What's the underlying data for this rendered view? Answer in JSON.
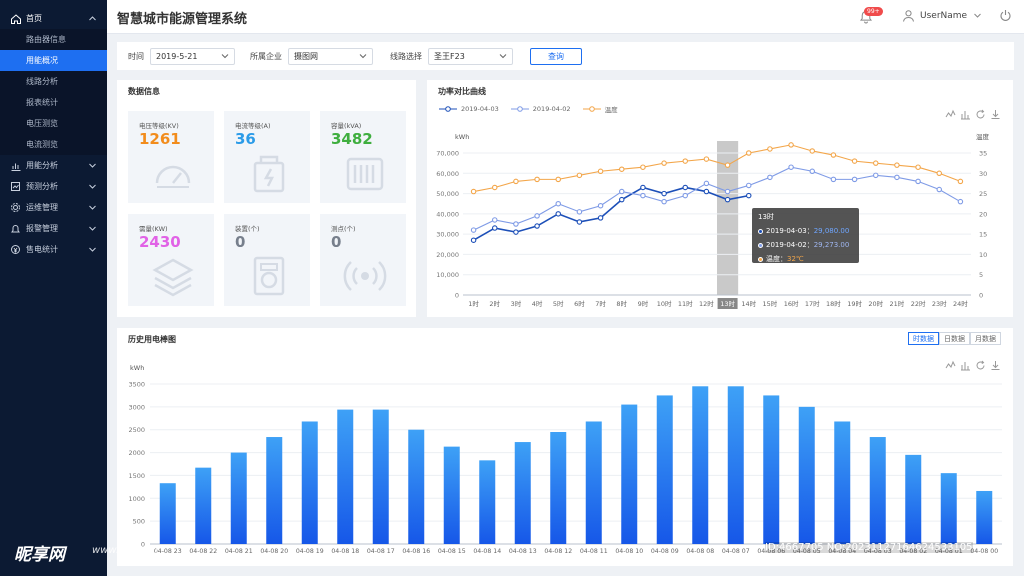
{
  "sidebar": {
    "items": [
      {
        "label": "首页",
        "icon": "home-icon",
        "expanded": true,
        "subs": [
          "路由器信息",
          "用能概况",
          "线路分析",
          "报表统计",
          "电压测览",
          "电流测览"
        ]
      },
      {
        "label": "用能分析",
        "icon": "chart-icon"
      },
      {
        "label": "预测分析",
        "icon": "forecast-icon"
      },
      {
        "label": "运维管理",
        "icon": "gear-icon"
      },
      {
        "label": "报警管理",
        "icon": "alarm-icon"
      },
      {
        "label": "售电统计",
        "icon": "coin-icon"
      }
    ],
    "active_sub": "用能概况"
  },
  "header": {
    "title": "智慧城市能源管理系统",
    "badge": "99+",
    "username": "UserName"
  },
  "filter": {
    "time_label": "时间",
    "time_value": "2019-5-21",
    "company_label": "所属企业",
    "company_value": "摄图网",
    "line_label": "线路选择",
    "line_value": "圣王F23",
    "query_label": "查询"
  },
  "data_info": {
    "title": "数据信息",
    "cards": [
      {
        "label": "电压等级(KV)",
        "value": "1261",
        "color": "#f28c1c",
        "icon": "gauge-icon"
      },
      {
        "label": "电流等级(A)",
        "value": "36",
        "color": "#2b9be8",
        "icon": "battery-icon"
      },
      {
        "label": "容量(kVA)",
        "value": "3482",
        "color": "#3fae3f",
        "icon": "transformer-icon"
      },
      {
        "label": "需量(KW)",
        "value": "2430",
        "color": "#e162e6",
        "icon": "layers-icon"
      },
      {
        "label": "装置(个)",
        "value": "0",
        "color": "#777f8c",
        "icon": "device-icon"
      },
      {
        "label": "测点(个)",
        "value": "0",
        "color": "#777f8c",
        "icon": "signal-icon"
      }
    ]
  },
  "power_chart": {
    "title": "功率对比曲线",
    "tooltip": {
      "title": "13时",
      "r1_label": "2019-04-03",
      "r1_value": "29,080.00",
      "r2_label": "2019-04-02",
      "r2_value": "29,273.00",
      "r3_label": "温度",
      "r3_value": "32℃"
    }
  },
  "bar_panel": {
    "title": "历史用电棒图",
    "tabs": [
      "时数据",
      "日数据",
      "月数据"
    ],
    "active_tab": "时数据"
  },
  "watermark": {
    "logo": "昵享网",
    "url": "www.nipic.cn",
    "id": "ID:4667705 NO:20231127164624533105"
  },
  "chart_data": [
    {
      "type": "line",
      "title": "功率对比曲线",
      "categories": [
        "1时",
        "2时",
        "3时",
        "4时",
        "5时",
        "6时",
        "7时",
        "8时",
        "9时",
        "10时",
        "11时",
        "12时",
        "13时",
        "14时",
        "15时",
        "16时",
        "17时",
        "18时",
        "19时",
        "20时",
        "21时",
        "22时",
        "23时",
        "24时"
      ],
      "ylabel": "kWh",
      "y2label": "温度",
      "ylim": [
        0,
        70000
      ],
      "y2lim": [
        0,
        35
      ],
      "yticks": [
        0,
        10000,
        20000,
        30000,
        40000,
        50000,
        60000,
        70000
      ],
      "y2ticks": [
        0,
        5,
        10,
        15,
        20,
        25,
        30,
        35
      ],
      "highlight": "13时",
      "legend_position": "top-left",
      "series": [
        {
          "name": "2019-04-03",
          "color": "#1c4fb8",
          "axis": "left",
          "values": [
            27000,
            33000,
            31000,
            34000,
            40000,
            36000,
            38000,
            47000,
            53000,
            50000,
            53000,
            51000,
            47000,
            49000
          ]
        },
        {
          "name": "2019-04-02",
          "color": "#7f9be6",
          "axis": "left",
          "values": [
            32000,
            37000,
            35000,
            39000,
            45000,
            41000,
            44000,
            51000,
            49000,
            46000,
            49000,
            55000,
            51000,
            54000,
            58000,
            63000,
            61000,
            57000,
            57000,
            59000,
            58000,
            56000,
            52000,
            46000
          ]
        },
        {
          "name": "温度",
          "color": "#f3a64a",
          "axis": "right",
          "values": [
            25.5,
            26.5,
            28,
            28.5,
            28.5,
            29.5,
            30.5,
            31,
            31.5,
            32.5,
            33,
            33.5,
            32,
            35,
            36,
            37,
            35.5,
            34.5,
            33,
            32.5,
            32,
            31.5,
            30,
            28
          ]
        }
      ]
    },
    {
      "type": "bar",
      "title": "历史用电棒图",
      "ylabel": "kWh",
      "ylim": [
        0,
        3500
      ],
      "yticks": [
        0,
        500,
        1000,
        1500,
        2000,
        2500,
        3000,
        3500
      ],
      "categories": [
        "04-08 23",
        "04-08 22",
        "04-08 21",
        "04-08 20",
        "04-08 19",
        "04-08 18",
        "04-08 17",
        "04-08 16",
        "04-08 15",
        "04-08 14",
        "04-08 13",
        "04-08 12",
        "04-08 11",
        "04-08 10",
        "04-08 09",
        "04-08 08",
        "04-08 07",
        "04-08 06",
        "04-08 05",
        "04-08 04",
        "04-08 03",
        "04-08 02",
        "04-08 01",
        "04-08 00"
      ],
      "values": [
        1330,
        1670,
        2000,
        2340,
        2680,
        2940,
        2940,
        2500,
        2130,
        1830,
        2230,
        2450,
        2680,
        3050,
        3250,
        3450,
        3450,
        3250,
        3000,
        2680,
        2340,
        1950,
        1550,
        1160
      ]
    }
  ]
}
